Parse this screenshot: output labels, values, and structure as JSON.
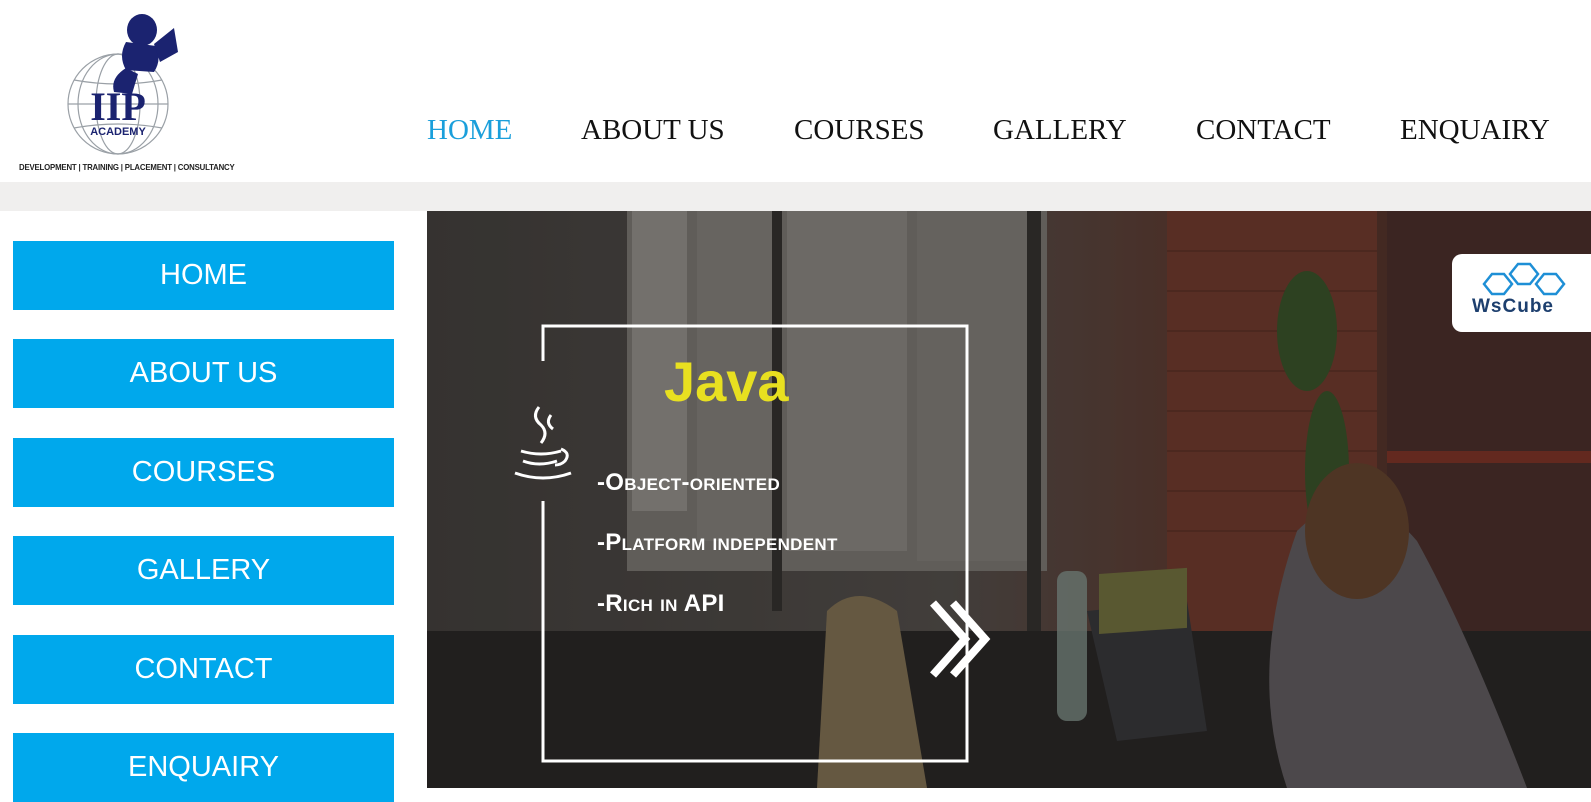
{
  "brand": {
    "logo_text": "IIP",
    "logo_sub": "ACADEMY",
    "tagline": "DEVELOPMENT | TRAINING | PLACEMENT | CONSULTANCY"
  },
  "topnav": {
    "items": [
      {
        "label": "HOME",
        "active": true
      },
      {
        "label": "ABOUT US"
      },
      {
        "label": "COURSES"
      },
      {
        "label": "GALLERY"
      },
      {
        "label": "CONTACT"
      },
      {
        "label": "ENQUAIRY"
      }
    ]
  },
  "sidebar": {
    "items": [
      {
        "label": "HOME"
      },
      {
        "label": "ABOUT US"
      },
      {
        "label": "COURSES"
      },
      {
        "label": "GALLERY"
      },
      {
        "label": "CONTACT"
      },
      {
        "label": "ENQUAIRY"
      }
    ]
  },
  "banner": {
    "title": "Java",
    "features": [
      "-Object-oriented",
      "-Platform independent",
      "-Rich in API"
    ],
    "watermark": "WsCube",
    "title_color": "#e8e020"
  },
  "colors": {
    "accent": "#00a8ec",
    "active_nav": "#1a9fdb"
  }
}
